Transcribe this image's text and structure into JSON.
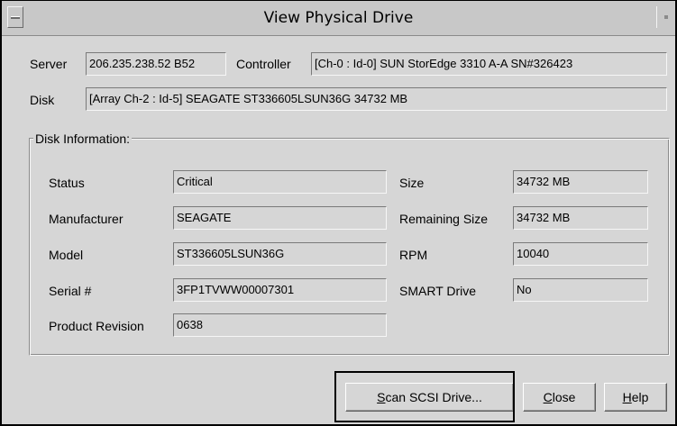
{
  "window": {
    "title": "View Physical Drive"
  },
  "header": {
    "server_label": "Server",
    "server_value": "206.235.238.52 B52",
    "controller_label": "Controller",
    "controller_value": "[Ch-0 : Id-0] SUN StorEdge 3310 A-A SN#326423",
    "disk_label": "Disk",
    "disk_value": "[Array Ch-2 : Id-5] SEAGATE ST336605LSUN36G 34732 MB"
  },
  "disk_info": {
    "group_title": "Disk Information:",
    "left": [
      {
        "label": "Status",
        "value": "Critical"
      },
      {
        "label": "Manufacturer",
        "value": "SEAGATE"
      },
      {
        "label": "Model",
        "value": "ST336605LSUN36G"
      },
      {
        "label": "Serial #",
        "value": "3FP1TVWW00007301"
      },
      {
        "label": "Product Revision",
        "value": "0638"
      }
    ],
    "right": [
      {
        "label": "Size",
        "value": "34732 MB"
      },
      {
        "label": "Remaining Size",
        "value": "34732 MB"
      },
      {
        "label": "RPM",
        "value": "10040"
      },
      {
        "label": "SMART Drive",
        "value": "No"
      }
    ]
  },
  "buttons": {
    "scan_first": "S",
    "scan_rest": "can SCSI Drive...",
    "close_first": "C",
    "close_rest": "lose",
    "help_first": "H",
    "help_rest": "elp"
  }
}
